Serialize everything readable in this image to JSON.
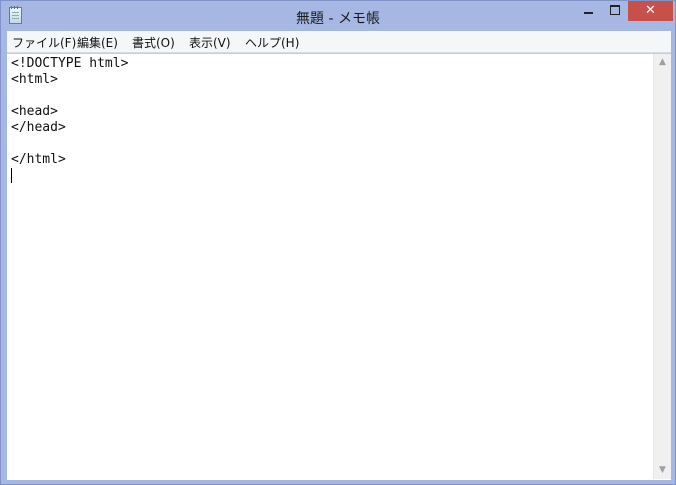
{
  "window": {
    "title": "無題 - メモ帳",
    "minimize_glyph": "",
    "maximize_glyph": "",
    "close_glyph": "✕"
  },
  "menu": {
    "items": [
      {
        "label": "ファイル(F)"
      },
      {
        "label": "編集(E)"
      },
      {
        "label": "書式(O)"
      },
      {
        "label": "表示(V)"
      },
      {
        "label": "ヘルプ(H)"
      }
    ]
  },
  "editor": {
    "content": "<!DOCTYPE html>\n<html>\n\n<head>\n</head>\n\n</html>\n"
  },
  "scrollbar": {
    "up_arrow": "▲",
    "down_arrow": "▼"
  },
  "icons": {
    "app": "notepad-icon"
  }
}
